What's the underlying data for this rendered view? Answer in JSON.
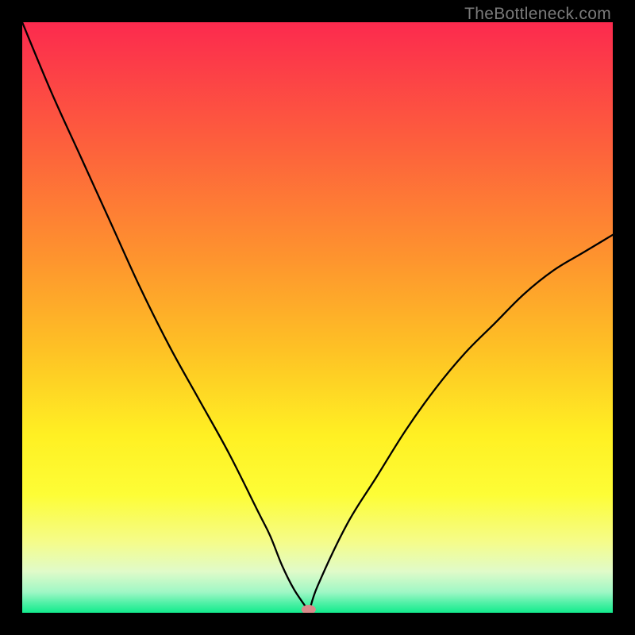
{
  "watermark": "TheBottleneck.com",
  "chart_data": {
    "type": "line",
    "title": "",
    "xlabel": "",
    "ylabel": "",
    "xlim": [
      0,
      100
    ],
    "ylim": [
      0,
      100
    ],
    "grid": false,
    "series": [
      {
        "name": "bottleneck-curve",
        "x": [
          0,
          5,
          10,
          15,
          20,
          25,
          30,
          35,
          40,
          42,
          44,
          46,
          48,
          48.5,
          50,
          55,
          60,
          65,
          70,
          75,
          80,
          85,
          90,
          95,
          100
        ],
        "values": [
          100,
          88,
          77,
          66,
          55,
          45,
          36,
          27,
          17,
          13,
          8,
          4,
          1,
          0,
          4.5,
          15,
          23,
          31,
          38,
          44,
          49,
          54,
          58,
          61,
          64
        ]
      }
    ],
    "marker": {
      "x": 48.5,
      "y": 0,
      "color": "#d98b8b"
    },
    "gradient_stops": [
      {
        "offset": 0.0,
        "color": "#fc2a4e"
      },
      {
        "offset": 0.2,
        "color": "#fd5e3d"
      },
      {
        "offset": 0.4,
        "color": "#fe942e"
      },
      {
        "offset": 0.55,
        "color": "#fec025"
      },
      {
        "offset": 0.7,
        "color": "#fff023"
      },
      {
        "offset": 0.8,
        "color": "#fdfd36"
      },
      {
        "offset": 0.88,
        "color": "#f5fc8a"
      },
      {
        "offset": 0.93,
        "color": "#e0fbc9"
      },
      {
        "offset": 0.965,
        "color": "#9ff7c5"
      },
      {
        "offset": 0.985,
        "color": "#4af0a4"
      },
      {
        "offset": 1.0,
        "color": "#13eb8d"
      }
    ]
  }
}
